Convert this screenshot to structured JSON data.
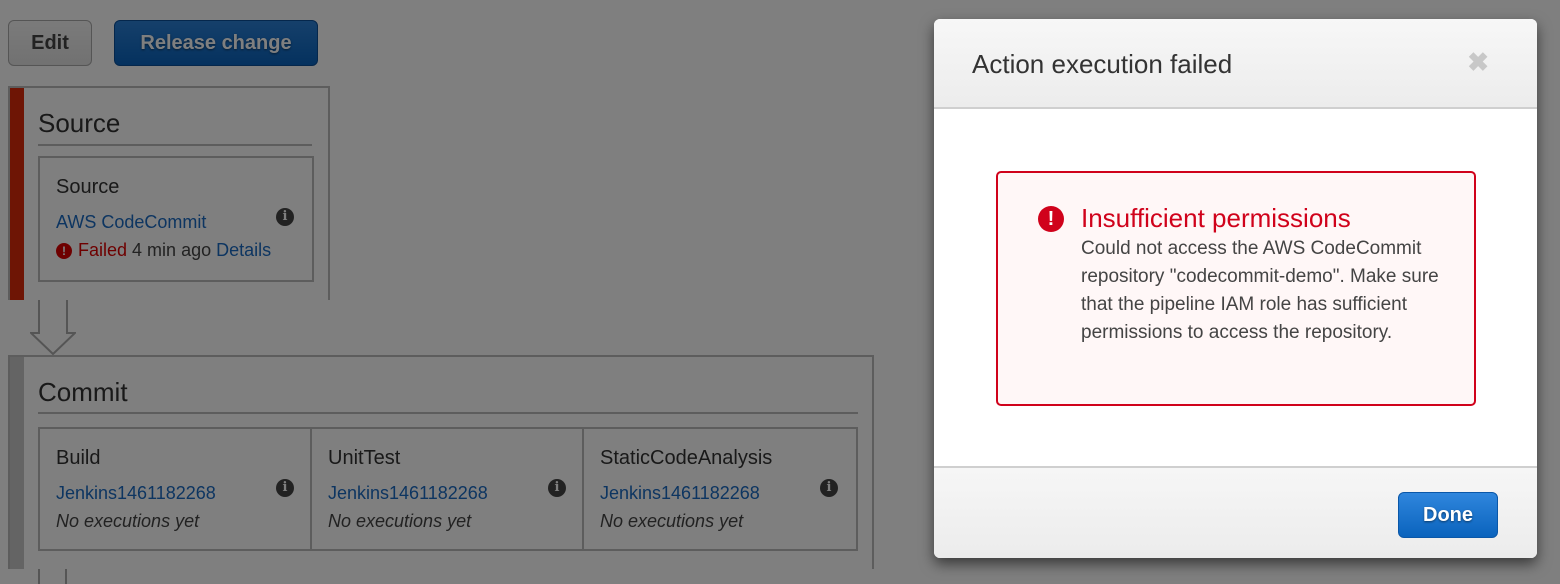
{
  "toolbar": {
    "edit_label": "Edit",
    "release_label": "Release change"
  },
  "stages": [
    {
      "title": "Source",
      "status_color": "#dd2a0a",
      "actions": [
        {
          "name": "Source",
          "provider": "AWS CodeCommit",
          "status_icon": "exclamation-circle-icon",
          "status": "Failed",
          "time": "4 min ago",
          "details_label": "Details"
        }
      ]
    },
    {
      "title": "Commit",
      "status_color": "#c9c9c9",
      "actions": [
        {
          "name": "Build",
          "provider": "Jenkins1461182268",
          "status": "No executions yet"
        },
        {
          "name": "UnitTest",
          "provider": "Jenkins1461182268",
          "status": "No executions yet"
        },
        {
          "name": "StaticCodeAnalysis",
          "provider": "Jenkins1461182268",
          "status": "No executions yet"
        }
      ]
    }
  ],
  "icons": {
    "info": "i",
    "error": "!",
    "close": "✖"
  },
  "modal": {
    "title": "Action execution failed",
    "alert": {
      "title": "Insufficient permissions",
      "message": "Could not access the AWS CodeCommit repository \"codecommit-demo\". Make sure that the pipeline IAM role has sufficient permissions to access the repository.",
      "color": "#d0021b"
    },
    "done_label": "Done"
  }
}
